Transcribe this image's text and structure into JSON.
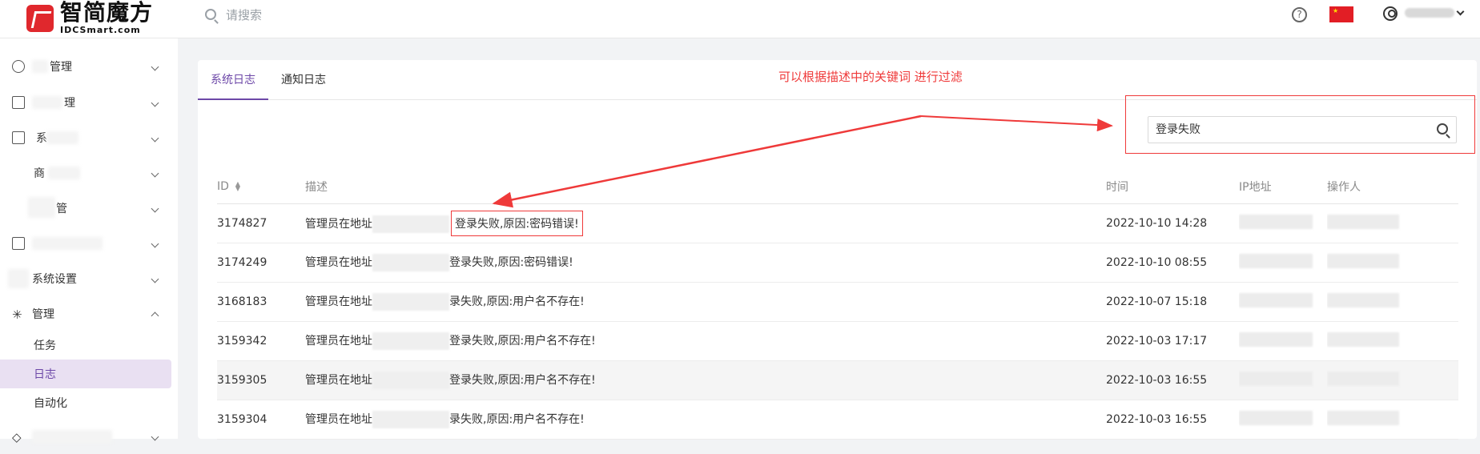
{
  "brand": {
    "name_cn": "智简魔方",
    "name_en": "IDCSmart.com"
  },
  "header": {
    "search_placeholder": "请搜索"
  },
  "sidebar": {
    "items": [
      {
        "label": "管理"
      },
      {
        "label": "理"
      },
      {
        "label": "系"
      },
      {
        "label": "商"
      },
      {
        "label": "管"
      },
      {
        "label": ""
      },
      {
        "label": "系统设置"
      },
      {
        "label": "管理"
      }
    ],
    "subitems": [
      {
        "label": "任务"
      },
      {
        "label": "日志"
      },
      {
        "label": "自动化"
      }
    ]
  },
  "main": {
    "tabs": [
      {
        "label": "系统日志"
      },
      {
        "label": "通知日志"
      }
    ],
    "note": "可以根据描述中的关键词 进行过滤",
    "filter_value": "登录失败",
    "columns": [
      "ID",
      "描述",
      "时间",
      "IP地址",
      "操作人"
    ],
    "rows": [
      {
        "id": "3174827",
        "desc_prefix": "管理员在地址",
        "desc_suffix": "登录失败,原因:密码错误!",
        "time": "2022-10-10 14:28"
      },
      {
        "id": "3174249",
        "desc_prefix": "管理员在地址",
        "desc_suffix": "登录失败,原因:密码错误!",
        "time": "2022-10-10 08:55"
      },
      {
        "id": "3168183",
        "desc_prefix": "管理员在地址",
        "desc_suffix": "录失败,原因:用户名不存在!",
        "time": "2022-10-07 15:18"
      },
      {
        "id": "3159342",
        "desc_prefix": "管理员在地址",
        "desc_suffix": "登录失败,原因:用户名不存在!",
        "time": "2022-10-03 17:17"
      },
      {
        "id": "3159305",
        "desc_prefix": "管理员在地址",
        "desc_suffix": "登录失败,原因:用户名不存在!",
        "time": "2022-10-03 16:55"
      },
      {
        "id": "3159304",
        "desc_prefix": "管理员在地址",
        "desc_suffix": "录失败,原因:用户名不存在!",
        "time": "2022-10-03 16:55"
      }
    ]
  }
}
